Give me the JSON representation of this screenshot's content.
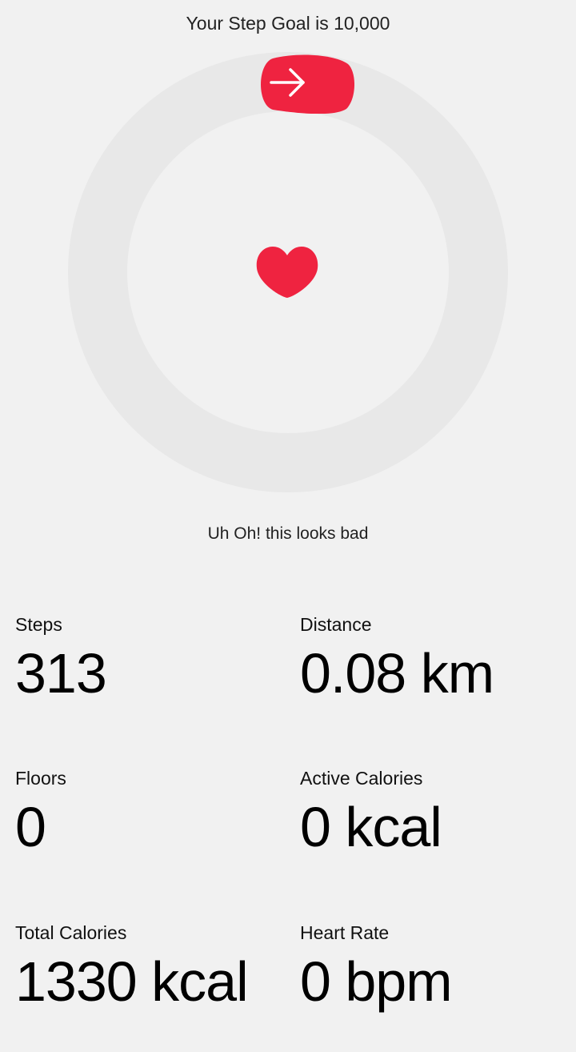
{
  "header": {
    "goal_text": "Your Step Goal is 10,000"
  },
  "progress": {
    "steps_fraction": 0.0313,
    "accent_color": "#ef2340",
    "track_color": "#e8e8e8",
    "icon": "arrow-right-icon",
    "center_icon": "heart-icon"
  },
  "status": {
    "message": "Uh Oh! this looks bad"
  },
  "stats": {
    "steps": {
      "label": "Steps",
      "value": "313"
    },
    "distance": {
      "label": "Distance",
      "value": "0.08 km"
    },
    "floors": {
      "label": "Floors",
      "value": "0"
    },
    "active_calories": {
      "label": "Active Calories",
      "value": "0 kcal"
    },
    "total_calories": {
      "label": "Total Calories",
      "value": "1330 kcal"
    },
    "heart_rate": {
      "label": "Heart Rate",
      "value": "0 bpm"
    }
  }
}
